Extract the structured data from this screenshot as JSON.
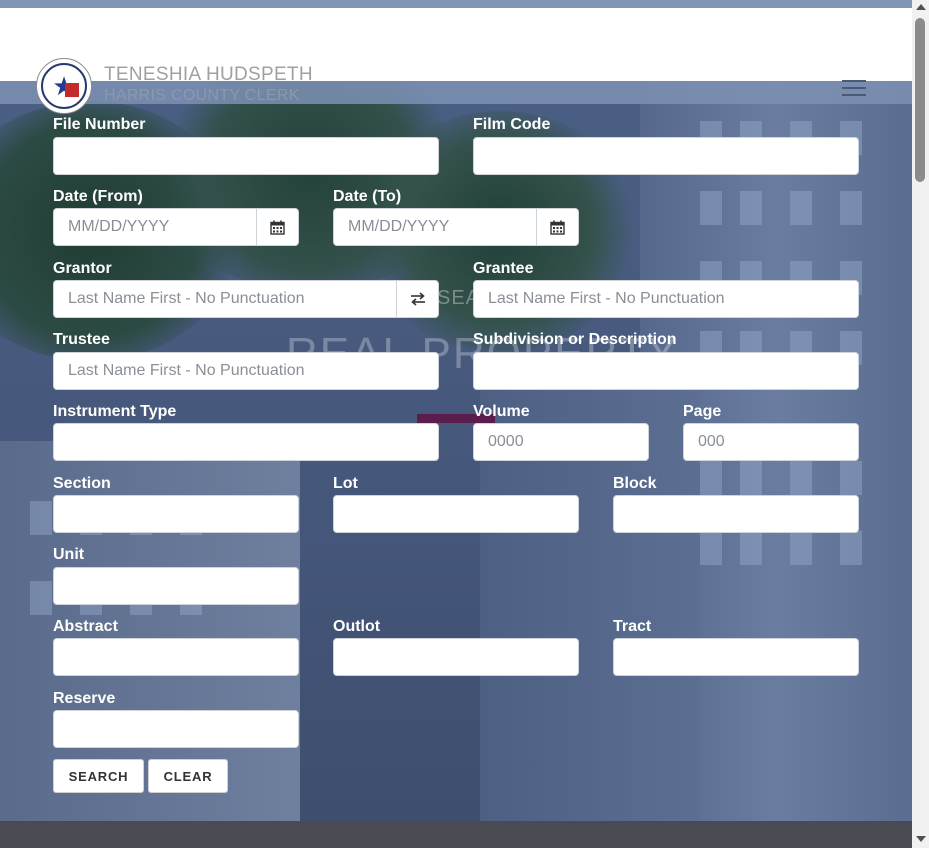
{
  "header": {
    "name": "TENESHIA HUDSPETH",
    "subtitle": "HARRIS COUNTY CLERK",
    "logo_text": "HARRIS COUNTY CLERK 1836"
  },
  "hero": {
    "subtitle": "SEA",
    "title": "REAL PROPERTY"
  },
  "form": {
    "file_number": {
      "label": "File Number",
      "value": "",
      "placeholder": ""
    },
    "film_code": {
      "label": "Film Code",
      "value": "",
      "placeholder": ""
    },
    "date_from": {
      "label": "Date (From)",
      "value": "",
      "placeholder": "MM/DD/YYYY"
    },
    "date_to": {
      "label": "Date (To)",
      "value": "",
      "placeholder": "MM/DD/YYYY"
    },
    "grantor": {
      "label": "Grantor",
      "value": "",
      "placeholder": "Last Name First - No Punctuation"
    },
    "grantee": {
      "label": "Grantee",
      "value": "",
      "placeholder": "Last Name First - No Punctuation"
    },
    "trustee": {
      "label": "Trustee",
      "value": "",
      "placeholder": "Last Name First - No Punctuation"
    },
    "subdivision": {
      "label": "Subdivision or Description",
      "value": "",
      "placeholder": ""
    },
    "instrument_type": {
      "label": "Instrument Type",
      "value": "",
      "placeholder": ""
    },
    "volume": {
      "label": "Volume",
      "value": "",
      "placeholder": "0000"
    },
    "page": {
      "label": "Page",
      "value": "",
      "placeholder": "000"
    },
    "section": {
      "label": "Section",
      "value": "",
      "placeholder": ""
    },
    "lot": {
      "label": "Lot",
      "value": "",
      "placeholder": ""
    },
    "block": {
      "label": "Block",
      "value": "",
      "placeholder": ""
    },
    "unit": {
      "label": "Unit",
      "value": "",
      "placeholder": ""
    },
    "abstract": {
      "label": "Abstract",
      "value": "",
      "placeholder": ""
    },
    "outlot": {
      "label": "Outlot",
      "value": "",
      "placeholder": ""
    },
    "tract": {
      "label": "Tract",
      "value": "",
      "placeholder": ""
    },
    "reserve": {
      "label": "Reserve",
      "value": "",
      "placeholder": ""
    }
  },
  "buttons": {
    "search": "SEARCH",
    "clear": "CLEAR"
  },
  "icons": {
    "calendar": "calendar-icon",
    "swap": "swap-arrows-icon",
    "menu": "hamburger-menu-icon"
  },
  "colors": {
    "header_band": "#7f96b6",
    "accent_line": "#5b1d4b",
    "footer": "#4a4b52",
    "label_text": "#ffffff"
  }
}
